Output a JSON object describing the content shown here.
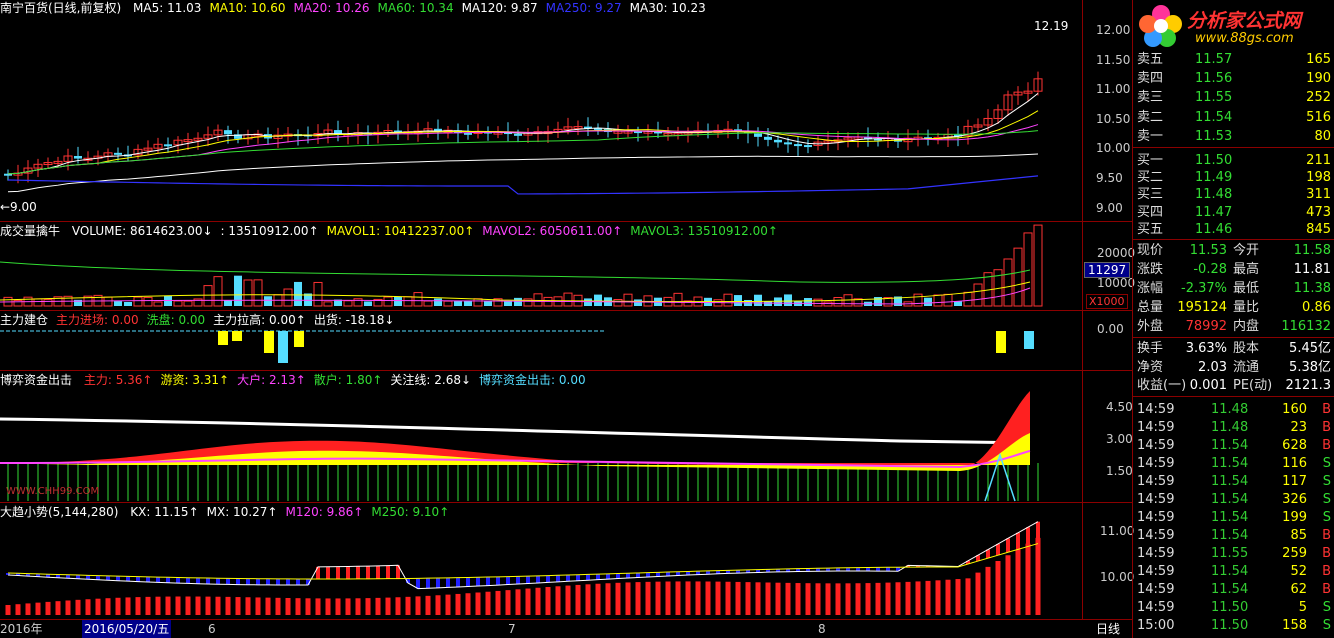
{
  "main": {
    "title": "南宁百货(日线,前复权)",
    "ma": [
      {
        "label": "MA5: 11.03",
        "color": "#ffffff"
      },
      {
        "label": "MA10: 10.60",
        "color": "#ffff00"
      },
      {
        "label": "MA20: 10.26",
        "color": "#ff44ff"
      },
      {
        "label": "MA60: 10.34",
        "color": "#33dd33"
      },
      {
        "label": "MA120: 9.87",
        "color": "#ffffff"
      },
      {
        "label": "MA250: 9.27",
        "color": "#3333ff"
      },
      {
        "label": "MA30: 10.23",
        "color": "#ffffff"
      }
    ],
    "high_mark": "12.19",
    "low_mark": "←9.00",
    "ticks": [
      "12.00",
      "11.50",
      "11.00",
      "10.50",
      "10.00",
      "9.50",
      "9.00"
    ]
  },
  "volume": {
    "title": "成交量擒牛",
    "labels": [
      {
        "text": "VOLUME: 8614623.00↓",
        "color": "#ffffff"
      },
      {
        "text": ": 13510912.00↑",
        "color": "#ffffff"
      },
      {
        "text": "MAVOL1: 10412237.00↑",
        "color": "#ffff00"
      },
      {
        "text": "MAVOL2: 6050611.00↑",
        "color": "#ff44ff"
      },
      {
        "text": "MAVOL3: 13510912.00↑",
        "color": "#33dd33"
      }
    ],
    "ticks": [
      "20000",
      "10000"
    ],
    "box_value": "11297",
    "unit": "X1000"
  },
  "force": {
    "labels": [
      {
        "text": "主力建仓",
        "color": "#ffffff"
      },
      {
        "text": "主力进场: 0.00",
        "color": "#ff3333"
      },
      {
        "text": "洗盘: 0.00",
        "color": "#33dd33"
      },
      {
        "text": "主力拉高: 0.00↑",
        "color": "#ffffff"
      },
      {
        "text": "出货: -18.18↓",
        "color": "#ffffff"
      }
    ],
    "tick": "0.00"
  },
  "fund": {
    "title": "博弈资金出击",
    "labels": [
      {
        "text": "主力: 5.36↑",
        "color": "#ff3333"
      },
      {
        "text": "游资: 3.31↑",
        "color": "#ffff00"
      },
      {
        "text": "大户: 2.13↑",
        "color": "#ff44ff"
      },
      {
        "text": "散户: 1.80↑",
        "color": "#33dd33"
      },
      {
        "text": "关注线: 2.68↓",
        "color": "#ffffff"
      },
      {
        "text": "博弈资金出击: 0.00",
        "color": "#55ddff"
      }
    ],
    "watermark": "WWW.CHH99.COM",
    "ticks": [
      "4.50",
      "3.00",
      "1.50"
    ]
  },
  "trend": {
    "title": "大趋小势(5,144,280)",
    "labels": [
      {
        "text": "KX: 11.15↑",
        "color": "#ffffff"
      },
      {
        "text": "MX: 10.27↑",
        "color": "#ffffff"
      },
      {
        "text": "M120: 9.86↑",
        "color": "#ff44ff"
      },
      {
        "text": "M250: 9.10↑",
        "color": "#33dd33"
      }
    ],
    "ticks": [
      "11.00",
      "10.00"
    ]
  },
  "datebar": {
    "year": "2016年",
    "date": "2016/05/20/五",
    "m6": "6",
    "m7": "7",
    "m8": "8",
    "period": "日线"
  },
  "logo": {
    "name": "分析家公式网",
    "url": "www.88gs.com"
  },
  "quote": {
    "asks": [
      {
        "label": "卖五",
        "price": "11.57",
        "vol": "165"
      },
      {
        "label": "卖四",
        "price": "11.56",
        "vol": "190"
      },
      {
        "label": "卖三",
        "price": "11.55",
        "vol": "252"
      },
      {
        "label": "卖二",
        "price": "11.54",
        "vol": "516"
      },
      {
        "label": "卖一",
        "price": "11.53",
        "vol": "80"
      }
    ],
    "bids": [
      {
        "label": "买一",
        "price": "11.50",
        "vol": "211"
      },
      {
        "label": "买二",
        "price": "11.49",
        "vol": "198"
      },
      {
        "label": "买三",
        "price": "11.48",
        "vol": "311"
      },
      {
        "label": "买四",
        "price": "11.47",
        "vol": "473"
      },
      {
        "label": "买五",
        "price": "11.46",
        "vol": "845"
      }
    ],
    "stats": [
      {
        "l1": "现价",
        "v1": "11.53",
        "c1": "#33dd33",
        "l2": "今开",
        "v2": "11.58",
        "c2": "#33dd33"
      },
      {
        "l1": "涨跌",
        "v1": "-0.28",
        "c1": "#33dd33",
        "l2": "最高",
        "v2": "11.81",
        "c2": "#ffffff"
      },
      {
        "l1": "涨幅",
        "v1": "-2.37%",
        "c1": "#33dd33",
        "l2": "最低",
        "v2": "11.38",
        "c2": "#33dd33"
      },
      {
        "l1": "总量",
        "v1": "195124",
        "c1": "#ffff00",
        "l2": "量比",
        "v2": "0.86",
        "c2": "#ffff00"
      },
      {
        "l1": "外盘",
        "v1": "78992",
        "c1": "#ff3333",
        "l2": "内盘",
        "v2": "116132",
        "c2": "#33dd33"
      }
    ],
    "stats2": [
      {
        "l1": "换手",
        "v1": "3.63%",
        "l2": "股本",
        "v2": "5.45亿"
      },
      {
        "l1": "净资",
        "v1": "2.03",
        "l2": "流通",
        "v2": "5.38亿"
      },
      {
        "l1": "收益(一)",
        "v1": "0.001",
        "l2": "PE(动)",
        "v2": "2121.3"
      }
    ],
    "trades": [
      {
        "t": "14:59",
        "p": "11.48",
        "v": "160",
        "s": "B"
      },
      {
        "t": "14:59",
        "p": "11.48",
        "v": "23",
        "s": "B"
      },
      {
        "t": "14:59",
        "p": "11.54",
        "v": "628",
        "s": "B"
      },
      {
        "t": "14:59",
        "p": "11.54",
        "v": "116",
        "s": "S"
      },
      {
        "t": "14:59",
        "p": "11.54",
        "v": "117",
        "s": "S"
      },
      {
        "t": "14:59",
        "p": "11.54",
        "v": "326",
        "s": "S"
      },
      {
        "t": "14:59",
        "p": "11.54",
        "v": "199",
        "s": "S"
      },
      {
        "t": "14:59",
        "p": "11.54",
        "v": "85",
        "s": "B"
      },
      {
        "t": "14:59",
        "p": "11.55",
        "v": "259",
        "s": "B"
      },
      {
        "t": "14:59",
        "p": "11.54",
        "v": "52",
        "s": "B"
      },
      {
        "t": "14:59",
        "p": "11.54",
        "v": "62",
        "s": "B"
      },
      {
        "t": "14:59",
        "p": "11.50",
        "v": "5",
        "s": "S"
      },
      {
        "t": "15:00",
        "p": "11.50",
        "v": "158",
        "s": "S"
      }
    ]
  },
  "colors": {
    "up": "#ff3333",
    "down": "#55ddff",
    "grid": "#8b0000"
  }
}
